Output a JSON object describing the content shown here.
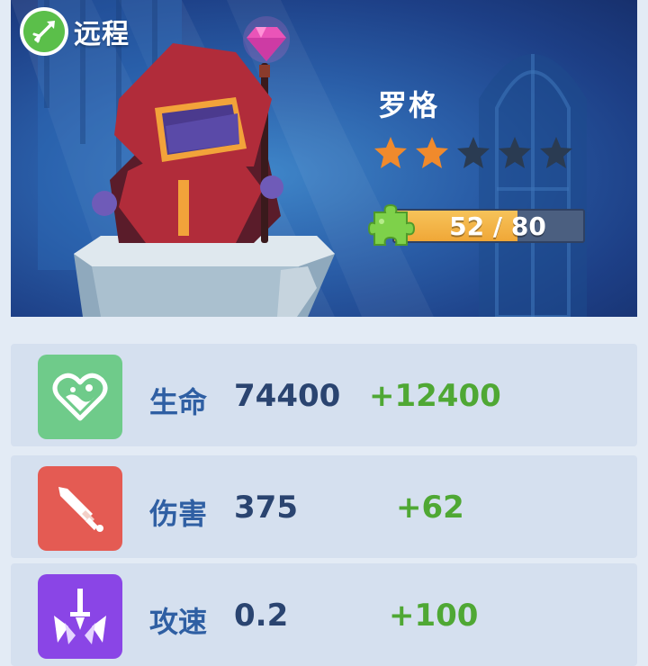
{
  "hero": {
    "type_label": "远程",
    "name": "罗格",
    "stars_filled": 2,
    "stars_total": 5,
    "shards_current": 52,
    "shards_required": 80,
    "shards_text": "52 / 80"
  },
  "stats": [
    {
      "label": "生命",
      "value": "74400",
      "bonus": "+12400",
      "icon": "heart-icon",
      "color": "#6fcb8a"
    },
    {
      "label": "伤害",
      "value": "375",
      "bonus": "+62",
      "icon": "sword-icon",
      "color": "#e45b53"
    },
    {
      "label": "攻速",
      "value": "0.2",
      "bonus": "+100",
      "icon": "attack-speed-icon",
      "color": "#8a45e6"
    }
  ],
  "colors": {
    "star_filled": "#f08a2c",
    "star_empty": "#2a3b52",
    "bonus_green": "#4fa834",
    "progress_fill": "#f2b043"
  }
}
